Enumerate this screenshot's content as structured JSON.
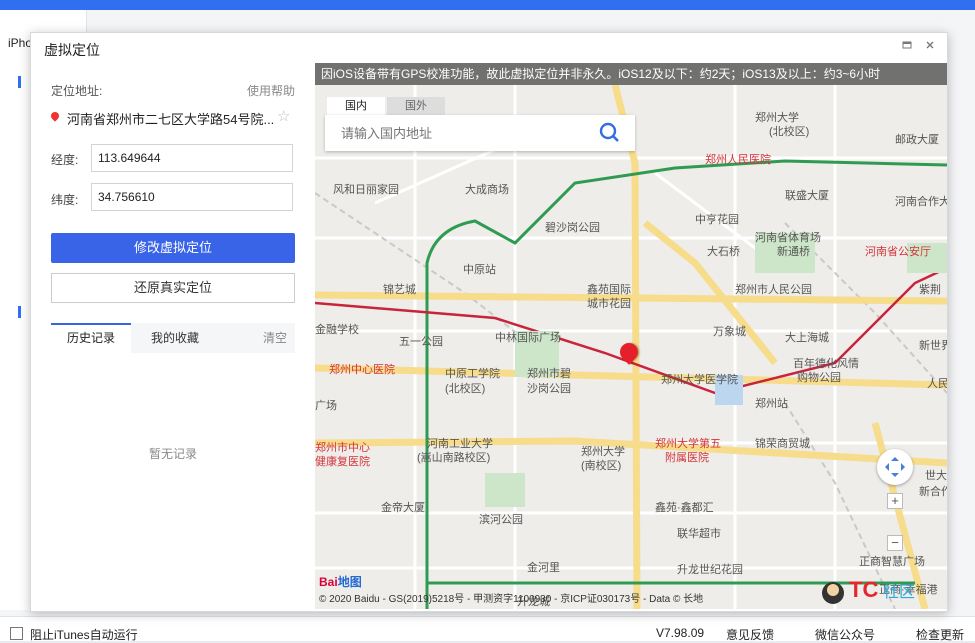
{
  "app": {
    "device_label": "iPho",
    "status_checkbox_label": "阻止iTunes自动运行",
    "version": "V7.98.09",
    "feedback": "意见反馈",
    "wechat": "微信公众号",
    "update": "检查更新"
  },
  "dialog": {
    "title": "虚拟定位",
    "min_icon": "window-min-icon",
    "close_icon": "close-icon"
  },
  "panel": {
    "address_label": "定位地址:",
    "help_link": "使用帮助",
    "address": "河南省郑州市二七区大学路54号院...",
    "longitude_label": "经度:",
    "longitude": "113.649644",
    "latitude_label": "纬度:",
    "latitude": "34.756610",
    "modify_button": "修改虚拟定位",
    "restore_button": "还原真实定位",
    "tabs": [
      "历史记录",
      "我的收藏"
    ],
    "clear": "清空",
    "empty": "暂无记录"
  },
  "map": {
    "notice": "因iOS设备带有GPS校准功能，故此虚拟定位并非永久。iOS12及以下：约2天；iOS13及以上：约3~6小时",
    "tabs": [
      "国内",
      "国外"
    ],
    "search_placeholder": "请输入国内地址",
    "logo": "Bai",
    "logo_suffix": "地图",
    "copyright": "© 2020 Baidu - GS(2019)5218号 - 甲测资字1100930 - 京ICP证030173号 - Data © 长地",
    "watermark": "TC社区 www.tcsqw.com",
    "places": [
      {
        "text": "郑州大学",
        "name": "place-zzu"
      },
      {
        "text": "(北校区)",
        "name": "place-zzu-north"
      },
      {
        "text": "邮政大厦",
        "name": "place-post"
      },
      {
        "text": "郑州人民医院",
        "name": "place-people-hospital"
      },
      {
        "text": "风和日丽家园",
        "name": "place-fenghe"
      },
      {
        "text": "大成商场",
        "name": "place-dacheng"
      },
      {
        "text": "联盛大厦",
        "name": "place-liansheng"
      },
      {
        "text": "中亨花园",
        "name": "place-zhongheng"
      },
      {
        "text": "河南合作大",
        "name": "place-hezuo"
      },
      {
        "text": "碧沙岗公园",
        "name": "place-bishagang-north"
      },
      {
        "text": "河南省体育场",
        "name": "place-stadium"
      },
      {
        "text": "大石桥",
        "name": "place-dashiqiao"
      },
      {
        "text": "新通桥",
        "name": "place-xintongqiao"
      },
      {
        "text": "河南省公安厅",
        "name": "place-police"
      },
      {
        "text": "中原站",
        "name": "place-zhongyuan"
      },
      {
        "text": "锦艺城",
        "name": "place-jinyi"
      },
      {
        "text": "鑫苑国际",
        "name": "place-xinyuan"
      },
      {
        "text": "城市花园",
        "name": "place-city-garden"
      },
      {
        "text": "郑州市人民公园",
        "name": "place-people-park"
      },
      {
        "text": "紫荆",
        "name": "place-zijing"
      },
      {
        "text": "金融学校",
        "name": "place-finance"
      },
      {
        "text": "万象城",
        "name": "place-wanxiang"
      },
      {
        "text": "中林国际广场",
        "name": "place-zhonglin"
      },
      {
        "text": "五一公园",
        "name": "place-wuyi"
      },
      {
        "text": "大上海城",
        "name": "place-shanghai"
      },
      {
        "text": "新世界",
        "name": "place-newworld"
      },
      {
        "text": "郑州中心医院",
        "name": "place-central-hospital"
      },
      {
        "text": "中原工学院",
        "name": "place-zut"
      },
      {
        "text": "(北校区)",
        "name": "place-zut-north"
      },
      {
        "text": "郑州市碧",
        "name": "place-bisha-1"
      },
      {
        "text": "沙岗公园",
        "name": "place-bisha-2"
      },
      {
        "text": "郑州大学医学院",
        "name": "place-medical"
      },
      {
        "text": "百年德化风情",
        "name": "place-dehua"
      },
      {
        "text": "购物公园",
        "name": "place-dehua-2"
      },
      {
        "text": "人民",
        "name": "place-renmin"
      },
      {
        "text": "广场",
        "name": "place-guangchang"
      },
      {
        "text": "郑州站",
        "name": "place-station"
      },
      {
        "text": "郑州市中心",
        "name": "place-center-1"
      },
      {
        "text": "健康复医院",
        "name": "place-center-2"
      },
      {
        "text": "河南工业大学",
        "name": "place-haut"
      },
      {
        "text": "(嵩山南路校区)",
        "name": "place-haut-2"
      },
      {
        "text": "郑州大学",
        "name": "place-zzu-south"
      },
      {
        "text": "(南校区)",
        "name": "place-zzu-south-2"
      },
      {
        "text": "郑州大学第五",
        "name": "place-fifth-1"
      },
      {
        "text": "附属医院",
        "name": "place-fifth-2"
      },
      {
        "text": "锦荣商贸城",
        "name": "place-jinrong"
      },
      {
        "text": "世大厦",
        "name": "place-shida"
      },
      {
        "text": "新合作",
        "name": "place-xinhezuo"
      },
      {
        "text": "金帝大厦",
        "name": "place-jindi"
      },
      {
        "text": "鑫苑·鑫都汇",
        "name": "place-xinduhui"
      },
      {
        "text": "滨河公园",
        "name": "place-binhe"
      },
      {
        "text": "联华超市",
        "name": "place-lianhua"
      },
      {
        "text": "正商智慧广场",
        "name": "place-zhengshang"
      },
      {
        "text": "金河里",
        "name": "place-jinheli"
      },
      {
        "text": "升龙世纪花园",
        "name": "place-shenglong"
      },
      {
        "text": "正商·幸福港",
        "name": "place-xingfu"
      },
      {
        "text": "升龙城",
        "name": "place-shenglongcheng"
      }
    ]
  }
}
